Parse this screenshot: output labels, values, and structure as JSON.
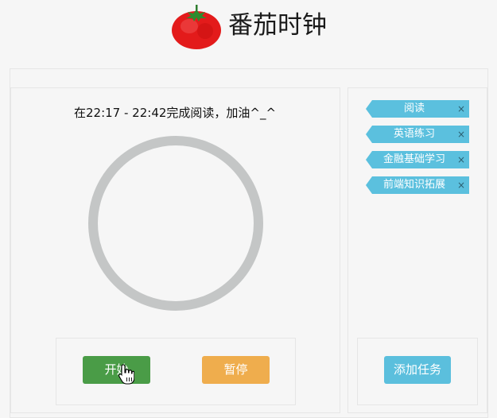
{
  "header": {
    "title": "番茄时钟"
  },
  "timer": {
    "status": "在22:17 - 22:42完成阅读，加油^_^"
  },
  "controls": {
    "start_label": "开始",
    "pause_label": "暂停",
    "add_task_label": "添加任务"
  },
  "tasks": [
    {
      "label": "阅读",
      "close": "×"
    },
    {
      "label": "英语练习",
      "close": "×"
    },
    {
      "label": "金融基础学习",
      "close": "×"
    },
    {
      "label": "前端知识拓展",
      "close": "×"
    }
  ],
  "colors": {
    "start": "#4a9c47",
    "pause": "#efad4d",
    "add": "#5bbfdd",
    "tag": "#5bc0de",
    "ring": "#c4c6c6",
    "tomato": "#e02424"
  }
}
